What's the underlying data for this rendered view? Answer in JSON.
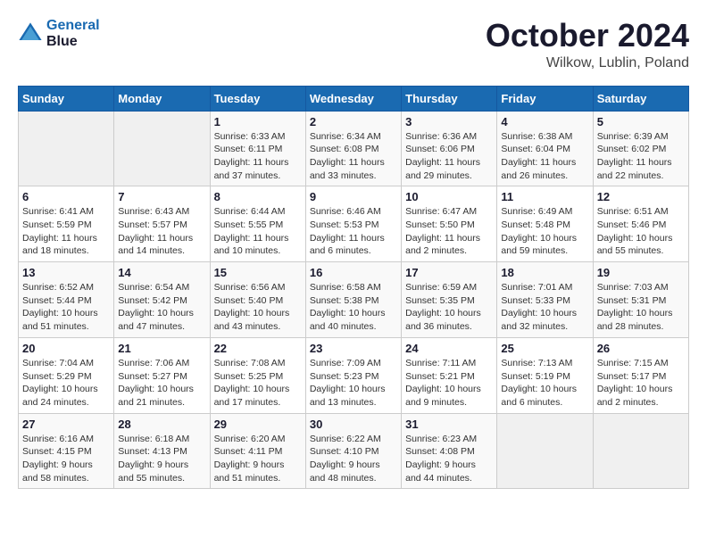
{
  "header": {
    "logo_line1": "General",
    "logo_line2": "Blue",
    "title": "October 2024",
    "subtitle": "Wilkow, Lublin, Poland"
  },
  "days_of_week": [
    "Sunday",
    "Monday",
    "Tuesday",
    "Wednesday",
    "Thursday",
    "Friday",
    "Saturday"
  ],
  "weeks": [
    [
      {
        "day": "",
        "detail": ""
      },
      {
        "day": "",
        "detail": ""
      },
      {
        "day": "1",
        "detail": "Sunrise: 6:33 AM\nSunset: 6:11 PM\nDaylight: 11 hours and 37 minutes."
      },
      {
        "day": "2",
        "detail": "Sunrise: 6:34 AM\nSunset: 6:08 PM\nDaylight: 11 hours and 33 minutes."
      },
      {
        "day": "3",
        "detail": "Sunrise: 6:36 AM\nSunset: 6:06 PM\nDaylight: 11 hours and 29 minutes."
      },
      {
        "day": "4",
        "detail": "Sunrise: 6:38 AM\nSunset: 6:04 PM\nDaylight: 11 hours and 26 minutes."
      },
      {
        "day": "5",
        "detail": "Sunrise: 6:39 AM\nSunset: 6:02 PM\nDaylight: 11 hours and 22 minutes."
      }
    ],
    [
      {
        "day": "6",
        "detail": "Sunrise: 6:41 AM\nSunset: 5:59 PM\nDaylight: 11 hours and 18 minutes."
      },
      {
        "day": "7",
        "detail": "Sunrise: 6:43 AM\nSunset: 5:57 PM\nDaylight: 11 hours and 14 minutes."
      },
      {
        "day": "8",
        "detail": "Sunrise: 6:44 AM\nSunset: 5:55 PM\nDaylight: 11 hours and 10 minutes."
      },
      {
        "day": "9",
        "detail": "Sunrise: 6:46 AM\nSunset: 5:53 PM\nDaylight: 11 hours and 6 minutes."
      },
      {
        "day": "10",
        "detail": "Sunrise: 6:47 AM\nSunset: 5:50 PM\nDaylight: 11 hours and 2 minutes."
      },
      {
        "day": "11",
        "detail": "Sunrise: 6:49 AM\nSunset: 5:48 PM\nDaylight: 10 hours and 59 minutes."
      },
      {
        "day": "12",
        "detail": "Sunrise: 6:51 AM\nSunset: 5:46 PM\nDaylight: 10 hours and 55 minutes."
      }
    ],
    [
      {
        "day": "13",
        "detail": "Sunrise: 6:52 AM\nSunset: 5:44 PM\nDaylight: 10 hours and 51 minutes."
      },
      {
        "day": "14",
        "detail": "Sunrise: 6:54 AM\nSunset: 5:42 PM\nDaylight: 10 hours and 47 minutes."
      },
      {
        "day": "15",
        "detail": "Sunrise: 6:56 AM\nSunset: 5:40 PM\nDaylight: 10 hours and 43 minutes."
      },
      {
        "day": "16",
        "detail": "Sunrise: 6:58 AM\nSunset: 5:38 PM\nDaylight: 10 hours and 40 minutes."
      },
      {
        "day": "17",
        "detail": "Sunrise: 6:59 AM\nSunset: 5:35 PM\nDaylight: 10 hours and 36 minutes."
      },
      {
        "day": "18",
        "detail": "Sunrise: 7:01 AM\nSunset: 5:33 PM\nDaylight: 10 hours and 32 minutes."
      },
      {
        "day": "19",
        "detail": "Sunrise: 7:03 AM\nSunset: 5:31 PM\nDaylight: 10 hours and 28 minutes."
      }
    ],
    [
      {
        "day": "20",
        "detail": "Sunrise: 7:04 AM\nSunset: 5:29 PM\nDaylight: 10 hours and 24 minutes."
      },
      {
        "day": "21",
        "detail": "Sunrise: 7:06 AM\nSunset: 5:27 PM\nDaylight: 10 hours and 21 minutes."
      },
      {
        "day": "22",
        "detail": "Sunrise: 7:08 AM\nSunset: 5:25 PM\nDaylight: 10 hours and 17 minutes."
      },
      {
        "day": "23",
        "detail": "Sunrise: 7:09 AM\nSunset: 5:23 PM\nDaylight: 10 hours and 13 minutes."
      },
      {
        "day": "24",
        "detail": "Sunrise: 7:11 AM\nSunset: 5:21 PM\nDaylight: 10 hours and 9 minutes."
      },
      {
        "day": "25",
        "detail": "Sunrise: 7:13 AM\nSunset: 5:19 PM\nDaylight: 10 hours and 6 minutes."
      },
      {
        "day": "26",
        "detail": "Sunrise: 7:15 AM\nSunset: 5:17 PM\nDaylight: 10 hours and 2 minutes."
      }
    ],
    [
      {
        "day": "27",
        "detail": "Sunrise: 6:16 AM\nSunset: 4:15 PM\nDaylight: 9 hours and 58 minutes."
      },
      {
        "day": "28",
        "detail": "Sunrise: 6:18 AM\nSunset: 4:13 PM\nDaylight: 9 hours and 55 minutes."
      },
      {
        "day": "29",
        "detail": "Sunrise: 6:20 AM\nSunset: 4:11 PM\nDaylight: 9 hours and 51 minutes."
      },
      {
        "day": "30",
        "detail": "Sunrise: 6:22 AM\nSunset: 4:10 PM\nDaylight: 9 hours and 48 minutes."
      },
      {
        "day": "31",
        "detail": "Sunrise: 6:23 AM\nSunset: 4:08 PM\nDaylight: 9 hours and 44 minutes."
      },
      {
        "day": "",
        "detail": ""
      },
      {
        "day": "",
        "detail": ""
      }
    ]
  ]
}
